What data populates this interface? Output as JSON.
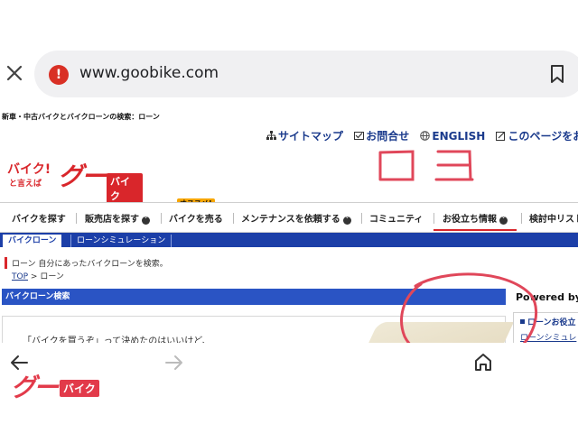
{
  "browser": {
    "url": "www.goobike.com",
    "close_icon": "close-icon",
    "warning_icon": "warning-icon",
    "warning_symbol": "!",
    "bookmark_icon": "bookmark-icon"
  },
  "page": {
    "h1": "新車・中古バイクとバイクローンの検索：ローン",
    "top_links": [
      {
        "label": "サイトマップ",
        "icon": "sitemap-icon"
      },
      {
        "label": "お問合せ",
        "icon": "mail-icon"
      },
      {
        "label": "ENGLISH",
        "icon": "globe-icon"
      },
      {
        "label": "このページをお",
        "icon": "edit-icon"
      }
    ],
    "logo": {
      "line1": "バイク!",
      "line2": "と言えば",
      "big": "グー",
      "badge": "バイク"
    },
    "annotation": "ココ",
    "nav": [
      {
        "label": "バイクを探す",
        "chevron": false
      },
      {
        "label": "販売店を探す",
        "chevron": true
      },
      {
        "label": "バイクを売る",
        "chevron": false
      },
      {
        "label": "メンテナンスを依頼する",
        "chevron": true
      },
      {
        "label": "コミュニティ",
        "chevron": false
      },
      {
        "label": "お役立ち情報",
        "chevron": true
      },
      {
        "label": "検討中リスト",
        "chevron": false
      }
    ],
    "nav_badge": "オススメ!",
    "subtabs": {
      "active": "バイクローン",
      "inactive": "ローンシミュレーション"
    },
    "description": "ローン 自分にあったバイクローンを検索。",
    "breadcrumb": {
      "top": "TOP",
      "sep": ">",
      "current": "ローン"
    },
    "section_title": "バイクローン検索",
    "panel_text": "「バイクを買うぞ」って決めたのはいいけど、",
    "powered_by": "Powered by",
    "side_links": [
      "ローンお役立",
      "ローンシミュレ"
    ],
    "colors": {
      "brand_red": "#d9262b",
      "nav_blue": "#1c3fa8",
      "annotation_red": "#e0475a"
    }
  },
  "bottom_nav": {
    "back_icon": "arrow-left-icon",
    "forward_icon": "arrow-right-icon",
    "home_icon": "home-icon"
  },
  "footer_logo": {
    "big": "グー",
    "badge": "バイク"
  }
}
